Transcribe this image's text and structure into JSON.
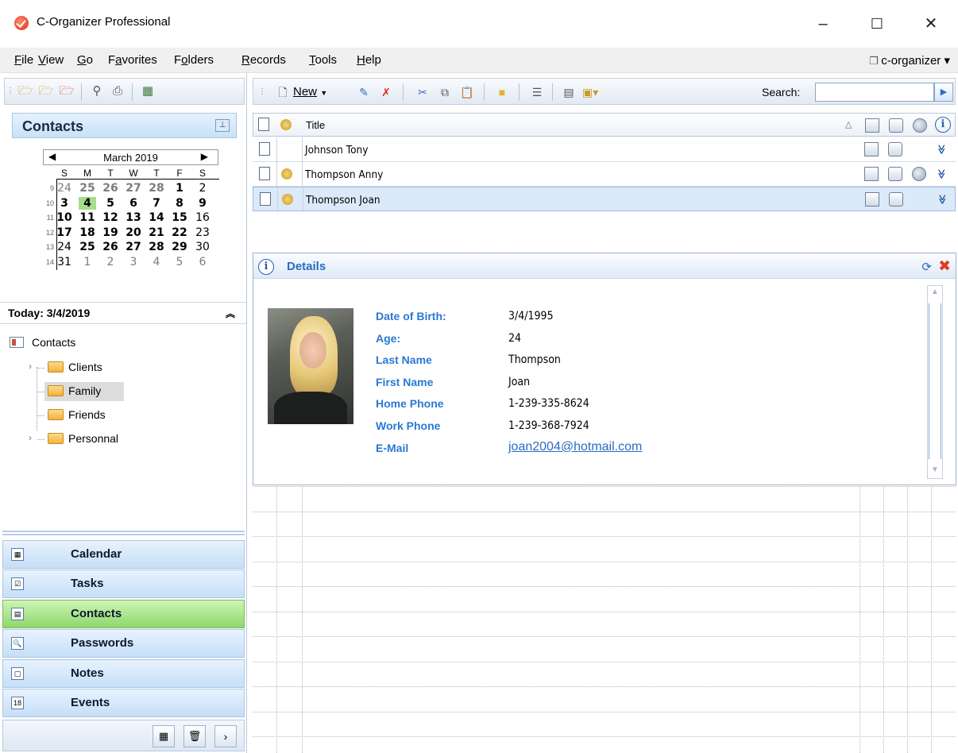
{
  "window": {
    "title": "C-Organizer Professional",
    "minimize": "–",
    "maximize": "☐",
    "close": "✕"
  },
  "menu": {
    "items": [
      {
        "pre": "",
        "u": "F",
        "post": "ile"
      },
      {
        "pre": "",
        "u": "V",
        "post": "iew"
      },
      {
        "pre": "",
        "u": "G",
        "post": "o"
      },
      {
        "pre": "F",
        "u": "a",
        "post": "vorites"
      },
      {
        "pre": "F",
        "u": "o",
        "post": "lders"
      },
      {
        "pre": "",
        "u": "R",
        "post": "ecords"
      },
      {
        "pre": "",
        "u": "T",
        "post": "ools"
      },
      {
        "pre": "",
        "u": "H",
        "post": "elp"
      }
    ],
    "organizer": "c-organizer ▾"
  },
  "left": {
    "header": "Contacts",
    "calendar": {
      "month": "March 2019",
      "weekdays": [
        "S",
        "M",
        "T",
        "W",
        "T",
        "F",
        "S"
      ],
      "weeks": [
        {
          "num": "9",
          "days": [
            {
              "d": "24",
              "c": "other"
            },
            {
              "d": "25",
              "c": "other bold"
            },
            {
              "d": "26",
              "c": "other bold"
            },
            {
              "d": "27",
              "c": "other bold"
            },
            {
              "d": "28",
              "c": "other bold"
            },
            {
              "d": "1",
              "c": "bold"
            },
            {
              "d": "2",
              "c": ""
            }
          ]
        },
        {
          "num": "10",
          "days": [
            {
              "d": "3",
              "c": "bold"
            },
            {
              "d": "4",
              "c": "bold today"
            },
            {
              "d": "5",
              "c": "bold"
            },
            {
              "d": "6",
              "c": "bold"
            },
            {
              "d": "7",
              "c": "bold"
            },
            {
              "d": "8",
              "c": "bold"
            },
            {
              "d": "9",
              "c": "bold"
            }
          ]
        },
        {
          "num": "11",
          "days": [
            {
              "d": "10",
              "c": "bold"
            },
            {
              "d": "11",
              "c": "bold"
            },
            {
              "d": "12",
              "c": "bold"
            },
            {
              "d": "13",
              "c": "bold"
            },
            {
              "d": "14",
              "c": "bold"
            },
            {
              "d": "15",
              "c": "bold"
            },
            {
              "d": "16",
              "c": ""
            }
          ]
        },
        {
          "num": "12",
          "days": [
            {
              "d": "17",
              "c": "bold"
            },
            {
              "d": "18",
              "c": "bold"
            },
            {
              "d": "19",
              "c": "bold"
            },
            {
              "d": "20",
              "c": "bold"
            },
            {
              "d": "21",
              "c": "bold"
            },
            {
              "d": "22",
              "c": "bold"
            },
            {
              "d": "23",
              "c": ""
            }
          ]
        },
        {
          "num": "13",
          "days": [
            {
              "d": "24",
              "c": ""
            },
            {
              "d": "25",
              "c": "bold"
            },
            {
              "d": "26",
              "c": "bold"
            },
            {
              "d": "27",
              "c": "bold"
            },
            {
              "d": "28",
              "c": "bold"
            },
            {
              "d": "29",
              "c": "bold"
            },
            {
              "d": "30",
              "c": ""
            }
          ]
        },
        {
          "num": "14",
          "days": [
            {
              "d": "31",
              "c": ""
            },
            {
              "d": "1",
              "c": "other"
            },
            {
              "d": "2",
              "c": "other"
            },
            {
              "d": "3",
              "c": "other"
            },
            {
              "d": "4",
              "c": "other"
            },
            {
              "d": "5",
              "c": "other"
            },
            {
              "d": "6",
              "c": "other"
            }
          ]
        }
      ]
    },
    "today": "Today: 3/4/2019",
    "tree": {
      "root": "Contacts",
      "folders": [
        "Clients",
        "Family",
        "Friends",
        "Personnal"
      ]
    },
    "nav": [
      "Calendar",
      "Tasks",
      "Contacts",
      "Passwords",
      "Notes",
      "Events"
    ],
    "nav_active": "Contacts"
  },
  "right": {
    "toolbar": {
      "new_label": "New",
      "search_label": "Search:",
      "search_value": ""
    },
    "grid": {
      "header_title": "Title",
      "rows": [
        {
          "title": "Johnson Tony",
          "speaker": false,
          "globe": false
        },
        {
          "title": "Thompson Anny",
          "speaker": true,
          "globe": true
        },
        {
          "title": "Thompson Joan",
          "speaker": true,
          "globe": false,
          "selected": true
        }
      ]
    },
    "details": {
      "title": "Details",
      "fields": [
        {
          "label": "Date of Birth:",
          "value": "3/4/1995"
        },
        {
          "label": "Age:",
          "value": "24"
        },
        {
          "label": "Last Name",
          "value": "Thompson"
        },
        {
          "label": "First Name",
          "value": "Joan"
        },
        {
          "label": "Home Phone",
          "value": "1-239-335-8624"
        },
        {
          "label": "Work Phone",
          "value": "1-239-368-7924"
        },
        {
          "label": "E-Mail",
          "value": "joan2004@hotmail.com",
          "link": true
        }
      ]
    }
  }
}
